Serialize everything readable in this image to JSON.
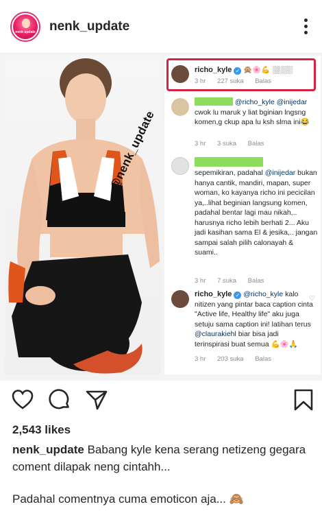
{
  "header": {
    "username": "nenk_update",
    "avatar_text": "nenk update"
  },
  "post": {
    "watermark": "@nenk_update"
  },
  "comments": [
    {
      "username": "richo_kyle",
      "verified": true,
      "text": "🙊🌸💪 ░░░░",
      "time": "3 hr",
      "likes": "227 suka",
      "reply": "Balas",
      "highlighted": true
    },
    {
      "username": "",
      "mentions": "@richo_kyle @inijedar",
      "text": "cwok lu maruk y liat bginian lngsng komen,g ckup apa lu ksh slma ini😂",
      "time": "3 hr",
      "likes": "3 suka",
      "reply": "Balas"
    },
    {
      "username": "",
      "text_lines": [
        "sepemikiran, padahal ",
        "@inijedar",
        " bukan hanya cantik, mandiri, mapan, super woman, ko kayanya richo ini pecicilan ya,..lihat beginian langsung komen, padahal bentar lagi mau nikah,.. harusnya richo lebih berhati 2... Aku jadi kasihan sama El & jesika,.. jangan sampai salah pilih calonayah & suami.."
      ],
      "time": "3 hr",
      "likes": "7 suka",
      "reply": "Balas"
    },
    {
      "username": "richo_kyle",
      "verified": true,
      "mention": "@richo_kyle",
      "text_a": " kalo nitizen yang pintar baca caption cinta \"Active life, Healthy life\" aku juga setuju sama caption ini! latihan terus ",
      "mention2": "@claurakiehl",
      "text_b": " biar bisa jadi terinspirasi buat semua 💪🌸🙏",
      "time": "3 hr",
      "likes": "203 suka",
      "reply": "Balas"
    }
  ],
  "actions": {
    "like": "heart-icon",
    "comment": "comment-icon",
    "share": "send-icon",
    "save": "bookmark-icon"
  },
  "likes": "2,543 likes",
  "caption": {
    "username": "nenk_update",
    "text": "Babang kyle kena serang netizeng gegara coment dilapak neng cintahh...",
    "text2": "Padahal comentnya cuma emoticon aja... 🙈"
  }
}
